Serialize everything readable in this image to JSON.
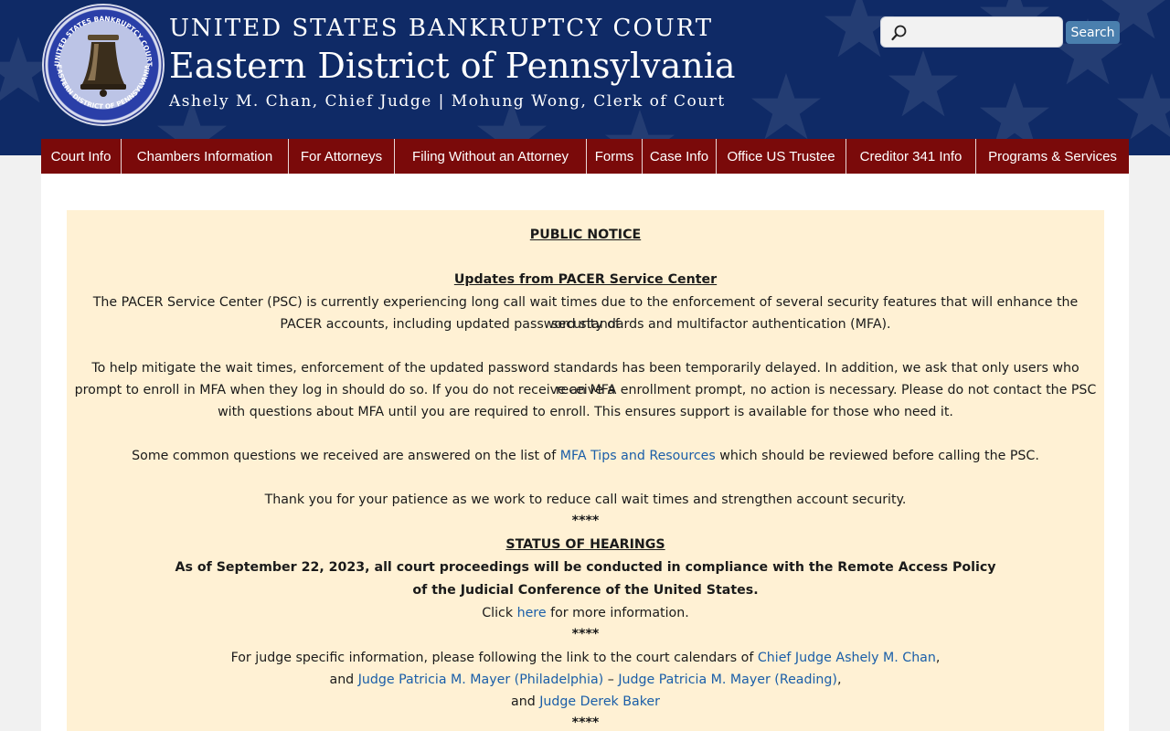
{
  "header": {
    "line1": "UNITED STATES BANKRUPTCY COURT",
    "line2": "Eastern District of Pennsylvania",
    "line3": "Ashely M. Chan, Chief Judge | Mohung Wong, Clerk of Court",
    "seal_top_text": "UNITED STATES BANKRUPTCY COURT",
    "seal_bottom_text": "EASTERN DISTRICT OF PENNSYLVANIA"
  },
  "search": {
    "value": "",
    "placeholder": "",
    "button_label": "Search"
  },
  "nav": [
    "Court Info",
    "Chambers Information",
    "For Attorneys",
    "Filing Without an Attorney",
    "Forms",
    "Case Info",
    "Office US Trustee",
    "Creditor 341 Info",
    "Programs & Services"
  ],
  "notice": {
    "heading": "PUBLIC NOTICE",
    "pacer_heading": "Updates from PACER Service Center",
    "p1_line1": "The PACER Service Center (PSC) is currently experiencing long call wait times due to the enforcement of several security features that will enhance the security of",
    "p1_line2": "PACER accounts, including updated password standards and multifactor authentication (MFA).",
    "p2_line1": "To help mitigate the wait times, enforcement of the updated password standards has been temporarily delayed. In addition, we ask that only users who receive a",
    "p2_line2": "prompt to enroll in MFA when they log in should do so. If you do not receive an MFA enrollment prompt, no action is necessary. Please do not contact the PSC",
    "p2_line3": "with questions about MFA until you are required to enroll. This ensures support is available for those who need it.",
    "p3_before": "Some common questions we received are answered on the list of ",
    "p3_link": "MFA Tips and Resources",
    "p3_after": " which should be reviewed before calling the PSC.",
    "p4": "Thank you for your patience as we work to reduce call wait times and strengthen account security.",
    "separator": "****",
    "status_heading": "STATUS OF HEARINGS",
    "status_line1": "As of September 22, 2023, all court proceedings will be conducted in compliance with the Remote Access Policy",
    "status_line2": "of the Judicial Conference of the United States.",
    "click_before": "Click ",
    "click_link": "here",
    "click_after": " for more information.",
    "judge_line1_before": "For judge specific information, please following the link to the court calendars of ",
    "judge_link_chan": "Chief Judge Ashely M. Chan",
    "judge_line1_after": ",",
    "judge_line2_before": "and ",
    "judge_link_mayer_phila": "Judge Patricia M. Mayer (Philadelphia)",
    "judge_line2_mid": " – ",
    "judge_link_mayer_reading": "Judge Patricia M. Mayer (Reading)",
    "judge_line2_after": ",",
    "judge_line3_before": "and ",
    "judge_link_baker": "Judge Derek Baker"
  },
  "colors": {
    "header_bg": "#0f2a66",
    "nav_bg": "#7a0a0a",
    "notice_bg": "#fff1d4",
    "link": "#1a5ea8",
    "search_button": "#4a7fae"
  },
  "icons": {
    "search": "magnifier-icon",
    "seal": "liberty-bell-seal-icon"
  }
}
